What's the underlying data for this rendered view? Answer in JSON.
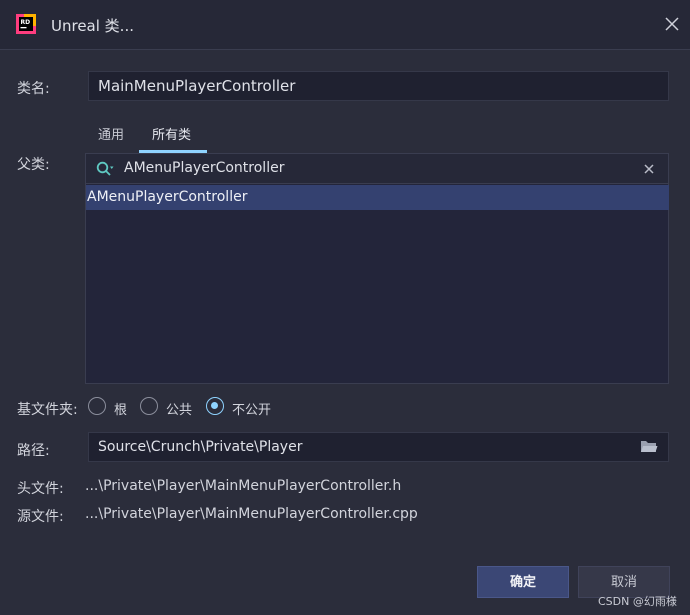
{
  "window": {
    "title": "Unreal 类..."
  },
  "form": {
    "class_name_label": "类名:",
    "class_name_value": "MainMenuPlayerController",
    "parent_label": "父类:",
    "tabs": [
      {
        "label": "通用"
      },
      {
        "label": "所有类",
        "active": true
      }
    ],
    "search_value": "AMenuPlayerController",
    "results": [
      {
        "label": "AMenuPlayerController",
        "selected": true
      }
    ],
    "base_folder_label": "基文件夹:",
    "base_folder_options": [
      {
        "label": "根",
        "checked": false
      },
      {
        "label": "公共",
        "checked": false
      },
      {
        "label": "不公开",
        "checked": true
      }
    ],
    "path_label": "路径:",
    "path_value": "Source\\Crunch\\Private\\Player",
    "header_file_label": "头文件:",
    "header_file_value": "...\\Private\\Player\\MainMenuPlayerController.h",
    "source_file_label": "源文件:",
    "source_file_value": "...\\Private\\Player\\MainMenuPlayerController.cpp"
  },
  "buttons": {
    "ok": "确定",
    "cancel": "取消"
  },
  "watermark": "CSDN @幻雨様",
  "icons": {
    "app": "rider-app-icon",
    "close": "close-icon",
    "search": "search-icon",
    "clear": "clear-icon",
    "folder": "folder-icon"
  },
  "colors": {
    "accent": "#8fd3ff",
    "selection": "#344170",
    "primary_button": "#3b4775"
  }
}
